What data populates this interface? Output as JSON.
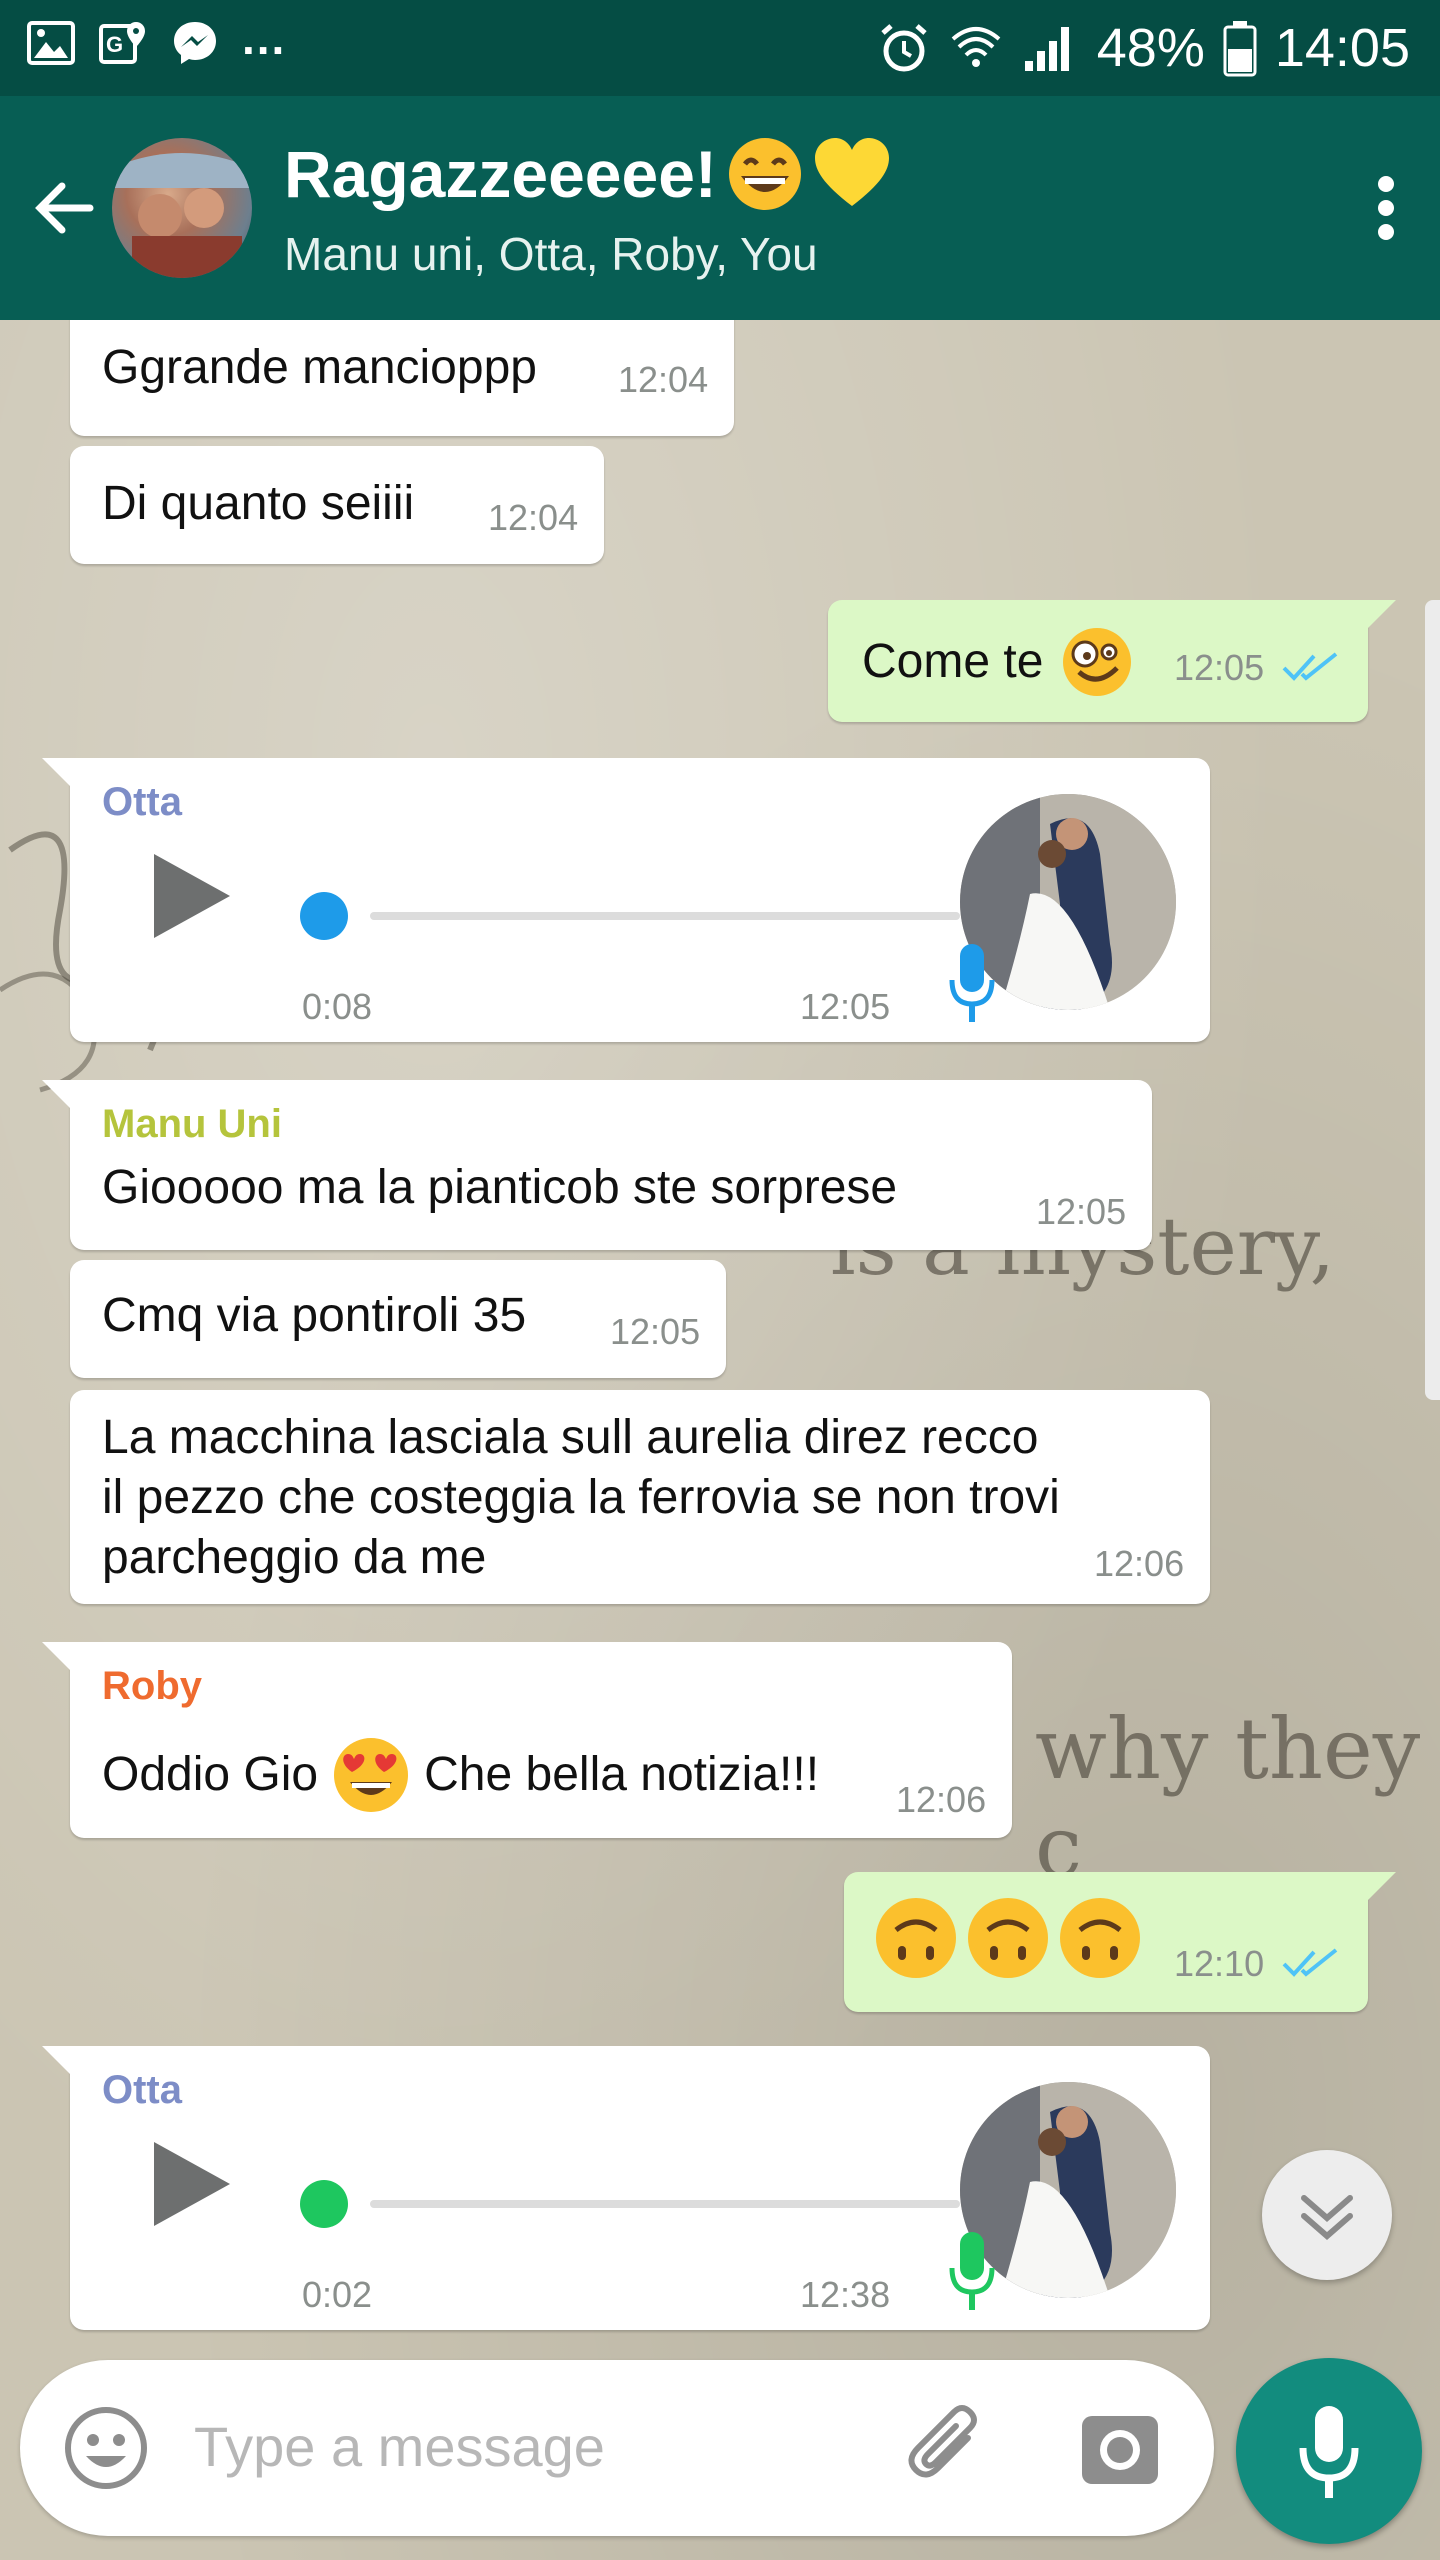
{
  "status_bar": {
    "battery": "48%",
    "time": "14:05",
    "more": "..."
  },
  "header": {
    "title": "Ragazzeeeee!",
    "subtitle": "Manu uni, Otta, Roby, You",
    "icons": [
      "back-arrow-icon",
      "group-avatar",
      "overflow-menu-icon"
    ]
  },
  "colors": {
    "header": "#075e54",
    "status_bar": "#054d44",
    "outgoing_bubble": "#dcf8c6",
    "incoming_bubble": "#ffffff",
    "read_ticks": "#4fc3f7",
    "otta_name": "#7d8dc7",
    "manu_name": "#b5c43c",
    "roby_name": "#ef6b2f",
    "mic_button": "#128c7e"
  },
  "messages": [
    {
      "text": "Ggrande mancioppp",
      "time": "12:04"
    },
    {
      "text": "Di quanto seiiii",
      "time": "12:04"
    },
    {
      "text": "Come te",
      "time": "12:05"
    },
    {
      "sender": "Otta",
      "duration": "0:08",
      "time": "12:05"
    },
    {
      "sender": "Manu Uni",
      "text": "Giooooo ma la pianticob ste sorprese",
      "time": "12:05"
    },
    {
      "text": "Cmq via pontiroli 35",
      "time": "12:05"
    },
    {
      "text": "La macchina lasciala sull aurelia direz recco\nil pezzo che costeggia la ferrovia se non trovi\nparcheggio da me",
      "time": "12:06"
    },
    {
      "sender": "Roby",
      "text_a": "Oddio Gio",
      "text_b": "Che bella notizia!!!",
      "time": "12:06"
    },
    {
      "time": "12:10"
    },
    {
      "sender": "Otta",
      "duration": "0:02",
      "time": "12:38"
    }
  ],
  "wallpaper_text": [
    "is a mystery,",
    "why they c"
  ],
  "input": {
    "placeholder": "Type a message"
  }
}
